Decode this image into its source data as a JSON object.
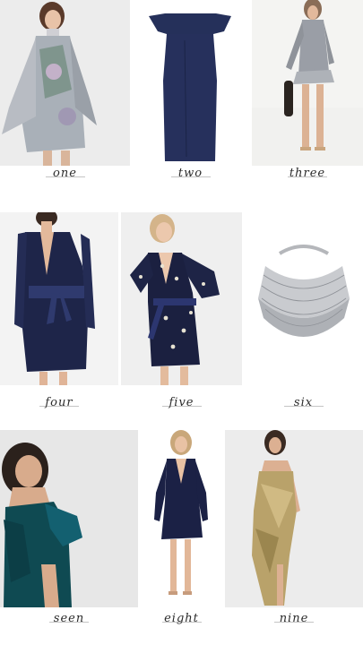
{
  "items": [
    {
      "caption": "one",
      "description": "sequin flared-sleeve mini dress"
    },
    {
      "caption": "two",
      "description": "navy off-shoulder sheath dress"
    },
    {
      "caption": "three",
      "description": "silver metallic ruffle mini dress"
    },
    {
      "caption": "four",
      "description": "navy velvet plunge dress with bow belt"
    },
    {
      "caption": "five",
      "description": "embellished velvet wrap dress"
    },
    {
      "caption": "six",
      "description": "crystal collar necklace"
    },
    {
      "caption": "seen",
      "description": "teal velvet off-shoulder dress"
    },
    {
      "caption": "eight",
      "description": "navy velvet plunge mini dress"
    },
    {
      "caption": "nine",
      "description": "gold sequin strapless gown"
    }
  ],
  "colors": {
    "navy": "#1d2647",
    "teal": "#0f4a52",
    "gold": "#b9a26a",
    "silver": "#b7b9bd",
    "caption": "#2b2b2b"
  }
}
